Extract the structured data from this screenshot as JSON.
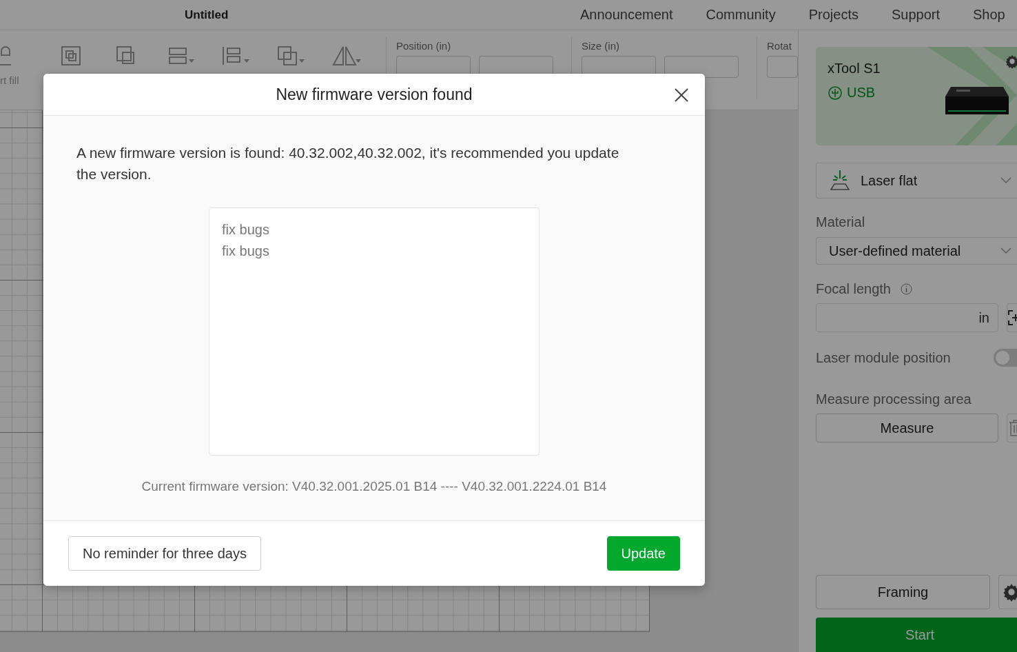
{
  "top_bar": {
    "title": "Untitled",
    "nav": [
      "Announcement",
      "Community",
      "Projects",
      "Support",
      "Shop"
    ]
  },
  "toolbar": {
    "cut_label": "rt fill",
    "position_label": "Position (in)",
    "size_label": "Size (in)",
    "rotate_label": "Rotat"
  },
  "device": {
    "name": "xTool S1",
    "connection": "USB"
  },
  "panel": {
    "mode": "Laser flat",
    "material_label": "Material",
    "material": "User-defined material",
    "focal_label": "Focal length",
    "focal_unit": "in",
    "module_position": {
      "label": "Laser module position",
      "on": false
    },
    "measure_label": "Measure processing area",
    "measure_button": "Measure",
    "framing_button": "Framing",
    "start_button": "Start"
  },
  "dialog": {
    "title": "New firmware version found",
    "message": "A new firmware version is found: 40.32.002,40.32.002, it's recommended you update the version.",
    "notes": [
      "fix bugs",
      "fix bugs"
    ],
    "version_info": "Current firmware version: V40.32.001.2025.01 B14 ---- V40.32.001.2224.01 B14",
    "buttons": [
      {
        "label": "No reminder for three days",
        "kind": "secondary"
      },
      {
        "label": "Update",
        "kind": "primary"
      }
    ]
  }
}
